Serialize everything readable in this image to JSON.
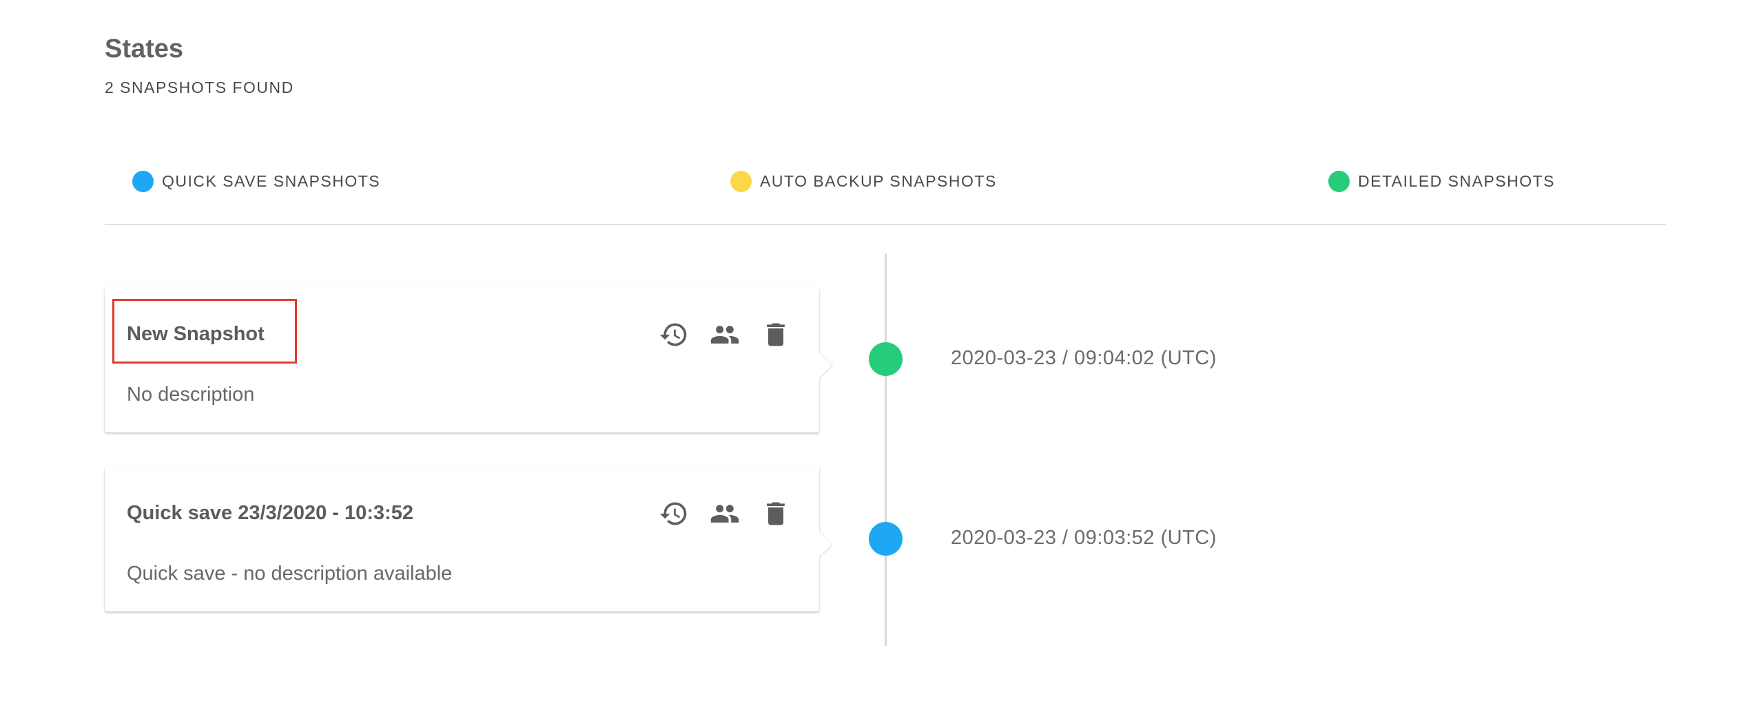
{
  "header": {
    "title": "States",
    "subtitle": "2 SNAPSHOTS FOUND"
  },
  "legend": [
    {
      "label": "QUICK SAVE SNAPSHOTS",
      "color": "#1ea7f2"
    },
    {
      "label": "AUTO BACKUP SNAPSHOTS",
      "color": "#fcd849"
    },
    {
      "label": "DETAILED SNAPSHOTS",
      "color": "#25cd7b"
    }
  ],
  "snapshots": [
    {
      "title": "New Snapshot",
      "description": "No description",
      "timestamp": "2020-03-23 / 09:04:02 (UTC)",
      "type": "detailed",
      "color": "#25cd7b",
      "highlighted": true
    },
    {
      "title": "Quick save 23/3/2020 - 10:3:52",
      "description": "Quick save - no description available",
      "timestamp": "2020-03-23 / 09:03:52 (UTC)",
      "type": "quick",
      "color": "#1ea7f2",
      "highlighted": false
    }
  ],
  "actions": {
    "restore_icon": "history-icon",
    "share_icon": "people-icon",
    "delete_icon": "trash-icon"
  }
}
